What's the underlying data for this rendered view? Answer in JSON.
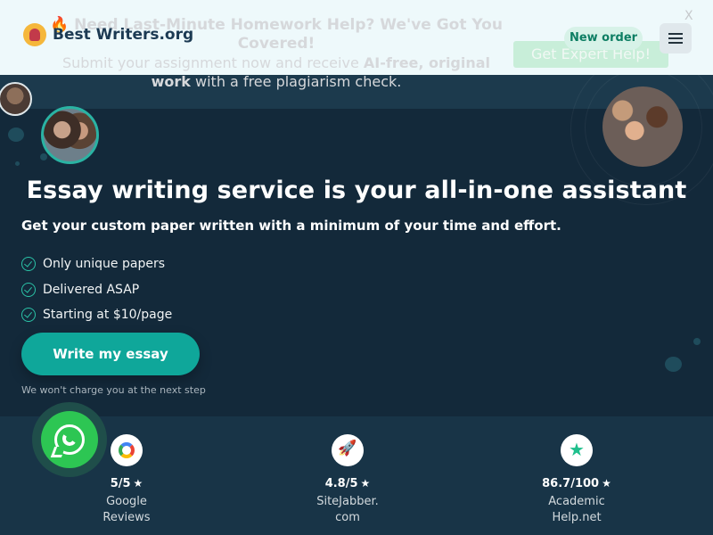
{
  "header": {
    "logo_text": "Best Writers.org",
    "new_order_label": "New order",
    "menu_icon": "hamburger-icon"
  },
  "banner": {
    "headline": "🔥 Need Last-Minute Homework Help? We've Got You Covered!",
    "text_before": "Submit your assignment now and receive ",
    "text_bold": "AI-free, original work",
    "text_after": " with a free plagiarism check.",
    "cta_label": "Get Expert Help!",
    "close_label": "X"
  },
  "hero": {
    "title": "Essay writing service is your all-in-one assistant",
    "subtitle": "Get your custom paper written with a minimum of your time and effort.",
    "features": [
      "Only unique papers",
      "Delivered ASAP",
      "Starting at $10/page"
    ],
    "cta_label": "Write my essay",
    "cta_note": "We won't charge you at the next step"
  },
  "reviews": [
    {
      "icon": "google-icon",
      "score": "5/5",
      "name_line1": "Google",
      "name_line2": "Reviews"
    },
    {
      "icon": "rocket-icon",
      "score": "4.8/5",
      "name_line1": "SiteJabber.",
      "name_line2": "com"
    },
    {
      "icon": "star-badge-icon",
      "score": "86.7/100",
      "name_line1": "Academic",
      "name_line2": "Help.net"
    }
  ],
  "colors": {
    "background": "#13293a",
    "accent": "#0fa79a",
    "check": "#2bc3a7",
    "whatsapp": "#2dc653"
  }
}
